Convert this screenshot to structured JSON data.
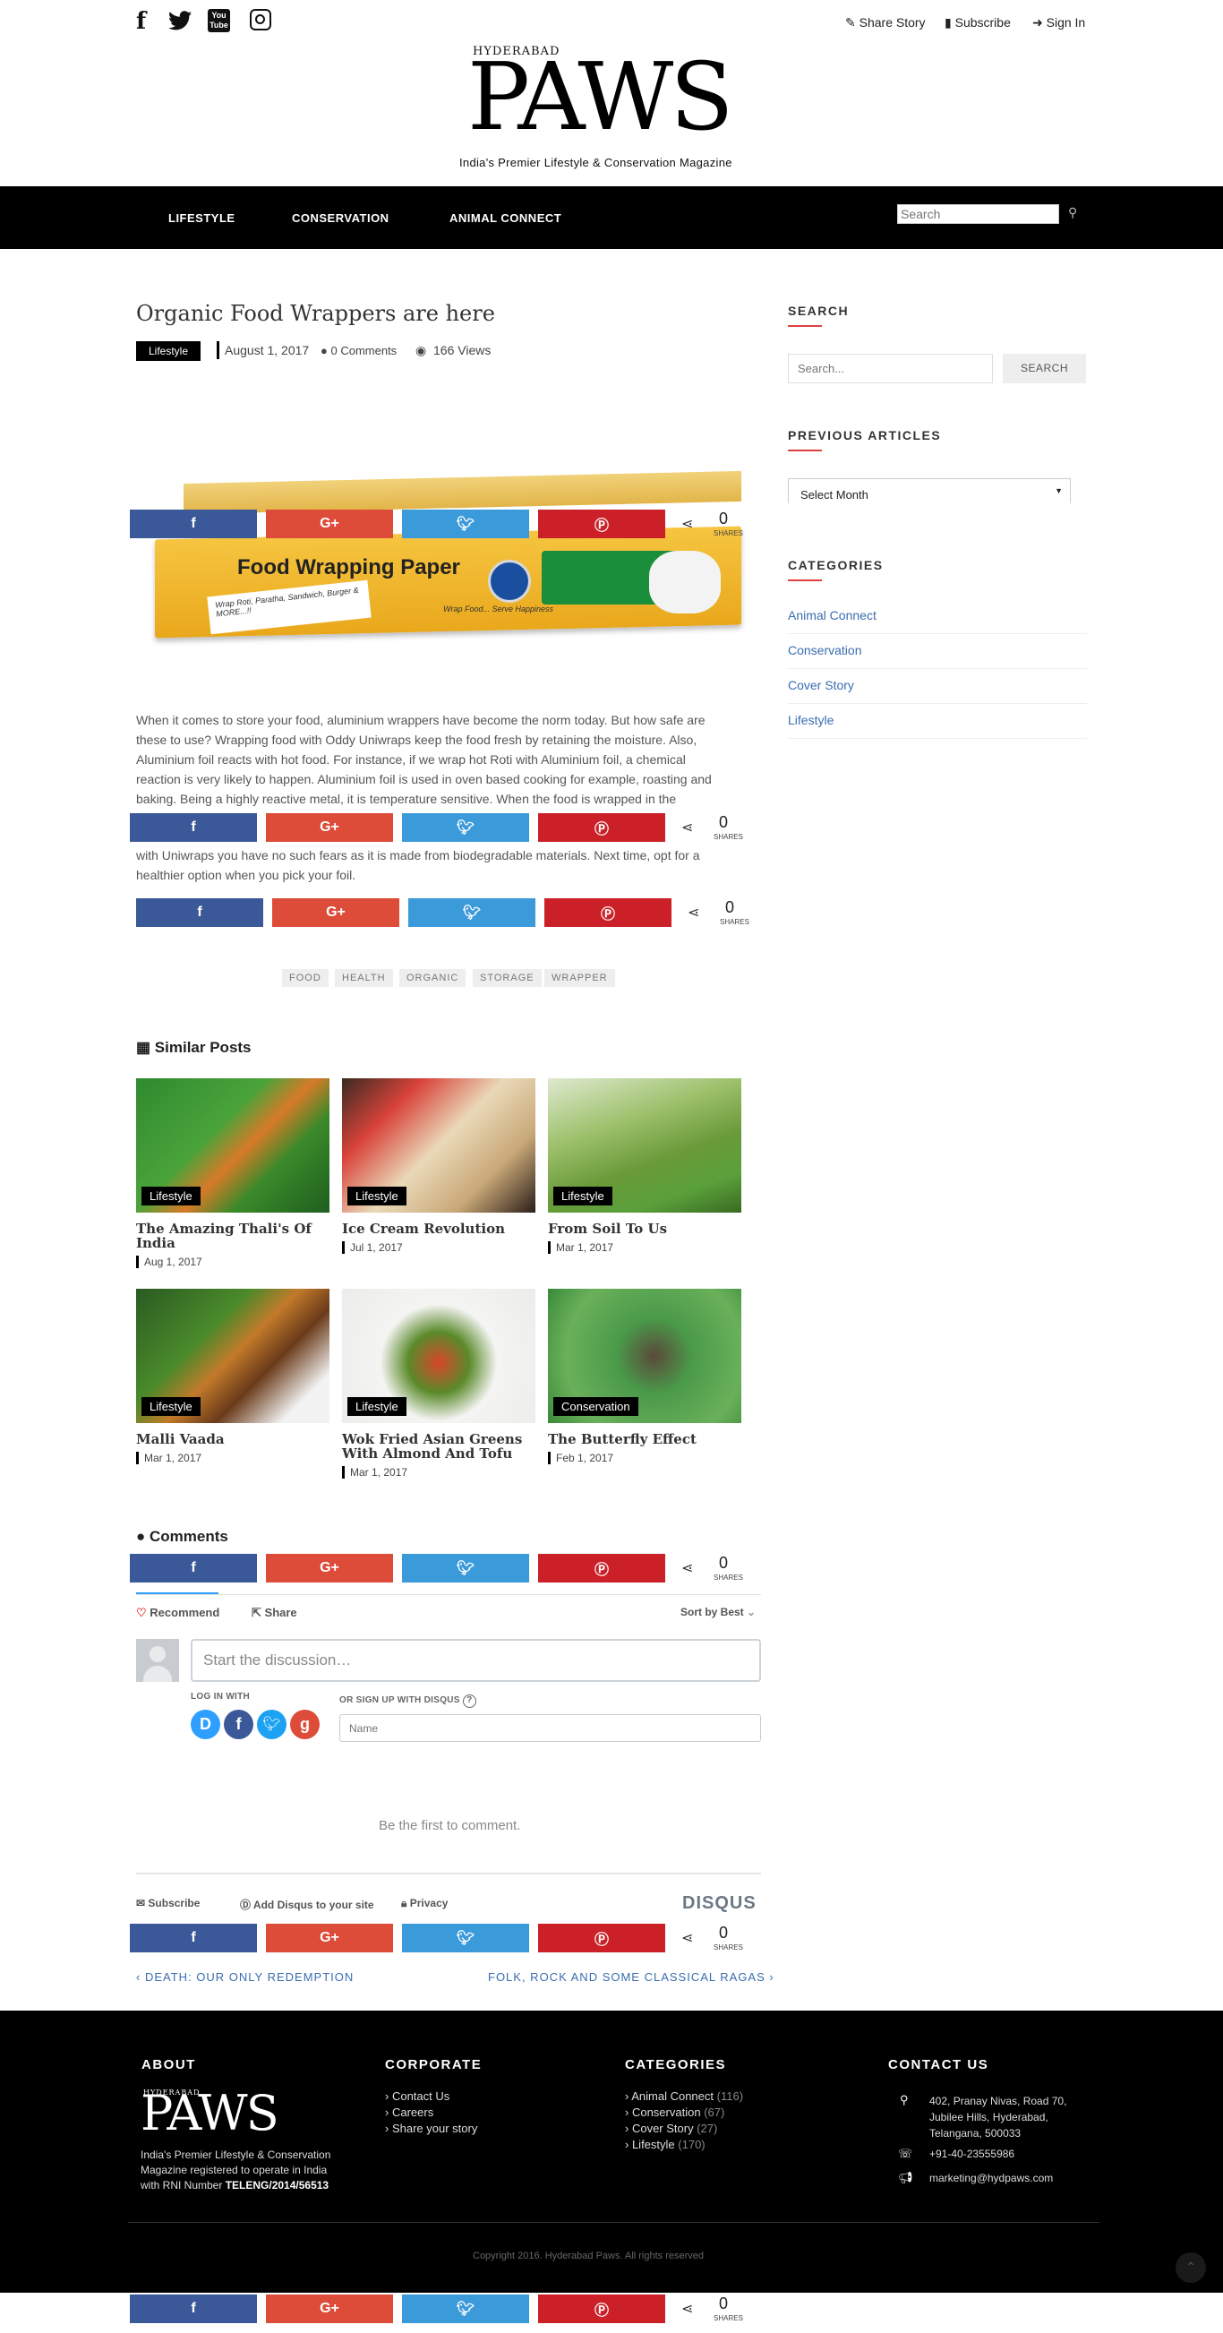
{
  "header": {
    "share_story": "Share Story",
    "subscribe": "Subscribe",
    "sign_in": "Sign In",
    "logo_small": "HYDERABAD",
    "logo_big": "PAWS",
    "tagline": "India's Premier Lifestyle & Conservation Magazine"
  },
  "nav": {
    "items": [
      "LIFESTYLE",
      "CONSERVATION",
      "ANIMAL CONNECT"
    ],
    "search_placeholder": "Search"
  },
  "article": {
    "title": "Organic Food Wrappers are here",
    "category": "Lifestyle",
    "date": "August 1, 2017",
    "comments": "0 Comments",
    "views": "166 Views",
    "product_title": "Food Wrapping Paper",
    "product_sub": "Wrap Roti, Paratha, Sandwich, Burger & MORE...!!",
    "product_slogan": "Wrap Food... Serve Happiness",
    "body_lines": [
      "When it comes to store your food, aluminium wrappers have become the norm today. But how safe are",
      "these to use? Wrapping food with Oddy Uniwraps keep the food fresh by retaining the moisture. Also,",
      "Aluminium foil reacts with hot food. For instance, if we wrap hot Roti with Aluminium foil, a chemical",
      "reaction is very likely to happen. Aluminium foil is used in oven based cooking for example, roasting and",
      "baking. Being a highly reactive metal, it is temperature sensitive. When the food is wrapped in the"
    ],
    "body_end_lines": [
      "with Uniwraps you have no such fears as it is made from biodegradable materials. Next time, opt for a",
      "healthier option when you pick your foil."
    ],
    "tags": [
      "FOOD",
      "HEALTH",
      "ORGANIC",
      "STORAGE",
      "WRAPPER"
    ]
  },
  "share": {
    "count": "0",
    "label": "SHARES"
  },
  "similar": {
    "heading": "Similar Posts",
    "posts": [
      {
        "title": "The Amazing Thali's Of India",
        "cat": "Lifestyle",
        "date": "Aug 1, 2017"
      },
      {
        "title": "Ice Cream Revolution",
        "cat": "Lifestyle",
        "date": "Jul 1, 2017"
      },
      {
        "title": "From Soil To Us",
        "cat": "Lifestyle",
        "date": "Mar 1, 2017"
      },
      {
        "title": "Malli Vaada",
        "cat": "Lifestyle",
        "date": "Mar 1, 2017"
      },
      {
        "title": "Wok Fried Asian Greens With Almond And Tofu",
        "cat": "Lifestyle",
        "date": "Mar 1, 2017"
      },
      {
        "title": "The Butterfly Effect",
        "cat": "Conservation",
        "date": "Feb 1, 2017"
      }
    ]
  },
  "comments": {
    "heading": "Comments",
    "recommend": "Recommend",
    "share": "Share",
    "sort": "Sort by Best",
    "placeholder": "Start the discussion…",
    "login_with": "LOG IN WITH",
    "signup": "OR SIGN UP WITH DISQUS",
    "name_placeholder": "Name",
    "empty": "Be the first to comment.",
    "subscribe": "Subscribe",
    "add_disqus": "Add Disqus to your site",
    "privacy": "Privacy",
    "brand": "DISQUS"
  },
  "post_nav": {
    "prev": "DEATH: OUR ONLY REDEMPTION",
    "next": "FOLK, ROCK AND SOME CLASSICAL RAGAS"
  },
  "sidebar": {
    "search_heading": "SEARCH",
    "search_placeholder": "Search...",
    "search_button": "SEARCH",
    "prev_heading": "PREVIOUS ARTICLES",
    "select_month": "Select Month",
    "cat_heading": "CATEGORIES",
    "categories": [
      "Animal Connect",
      "Conservation",
      "Cover Story",
      "Lifestyle"
    ]
  },
  "footer": {
    "about_heading": "ABOUT",
    "about_text": [
      "India's Premier Lifestyle & Conservation",
      "Magazine registered to operate in India",
      "with RNI Number"
    ],
    "rni": "TELENG/2014/56513",
    "corporate_heading": "CORPORATE",
    "corporate_links": [
      "Contact Us",
      "Careers",
      "Share your story"
    ],
    "categories_heading": "CATEGORIES",
    "categories": [
      {
        "name": "Animal Connect",
        "count": "(116)"
      },
      {
        "name": "Conservation",
        "count": "(67)"
      },
      {
        "name": "Cover Story",
        "count": "(27)"
      },
      {
        "name": "Lifestyle",
        "count": "(170)"
      }
    ],
    "contact_heading": "CONTACT US",
    "address": [
      "402, Pranay Nivas, Road 70,",
      "Jubilee Hills, Hyderabad,",
      "Telangana, 500033"
    ],
    "phone": "+91-40-23555986",
    "email": "marketing@hydpaws.com",
    "copyright": "Copyright 2016. Hyderabad Paws. All rights reserved"
  },
  "colors": {
    "facebook": "#3b5998",
    "google": "#dd4b39",
    "twitter": "#3b9ad9",
    "pinterest": "#cb2027",
    "accent_red": "#e04040",
    "link_blue": "#3a6db0"
  }
}
